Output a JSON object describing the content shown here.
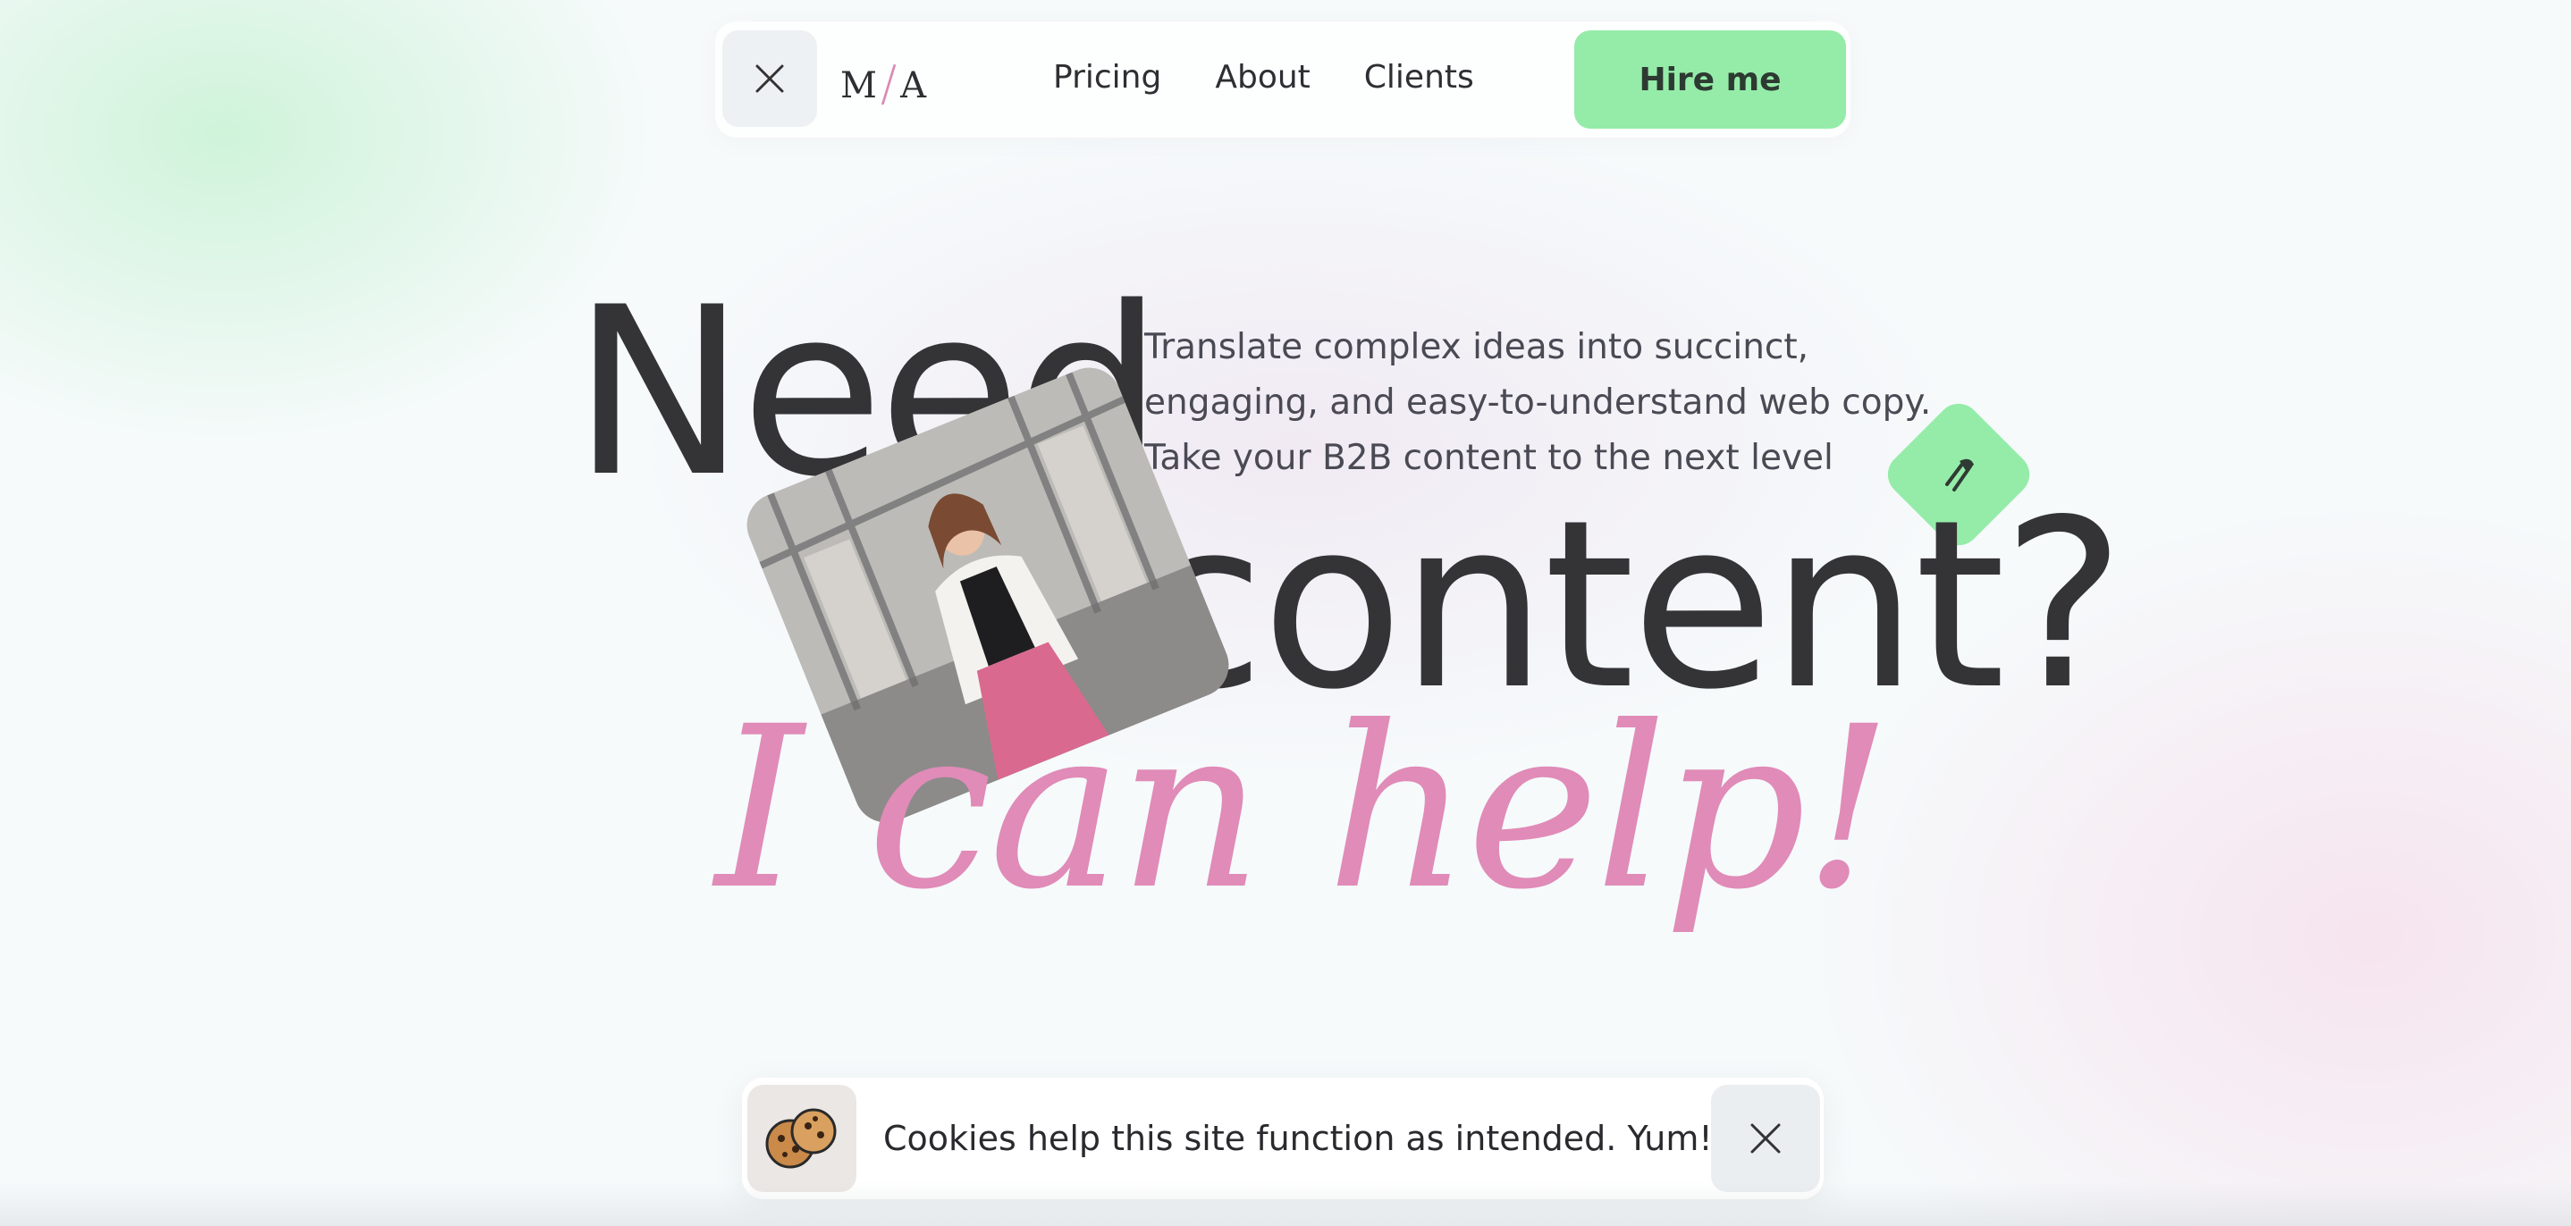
{
  "nav": {
    "logo": {
      "left": "M",
      "right": "A"
    },
    "links": [
      "Pricing",
      "About",
      "Clients"
    ],
    "cta_label": "Hire me",
    "close_icon": "close-icon"
  },
  "hero": {
    "headline_1": "Need",
    "headline_2": "content?",
    "tagline": "Translate complex ideas into succinct, engaging, and easy-to-understand web copy. Take your B2B content to the next level",
    "accent_text": "I can help!",
    "badge_icon": "pen-nib-icon",
    "photo_icon": "portrait-photo"
  },
  "cookie_banner": {
    "text": "Cookies help this site function as intended. Yum!",
    "icon": "cookie-icon",
    "close_icon": "close-icon"
  },
  "colors": {
    "accent_green": "#94eca8",
    "accent_pink": "#e08bb8",
    "text_dark": "#343436"
  }
}
